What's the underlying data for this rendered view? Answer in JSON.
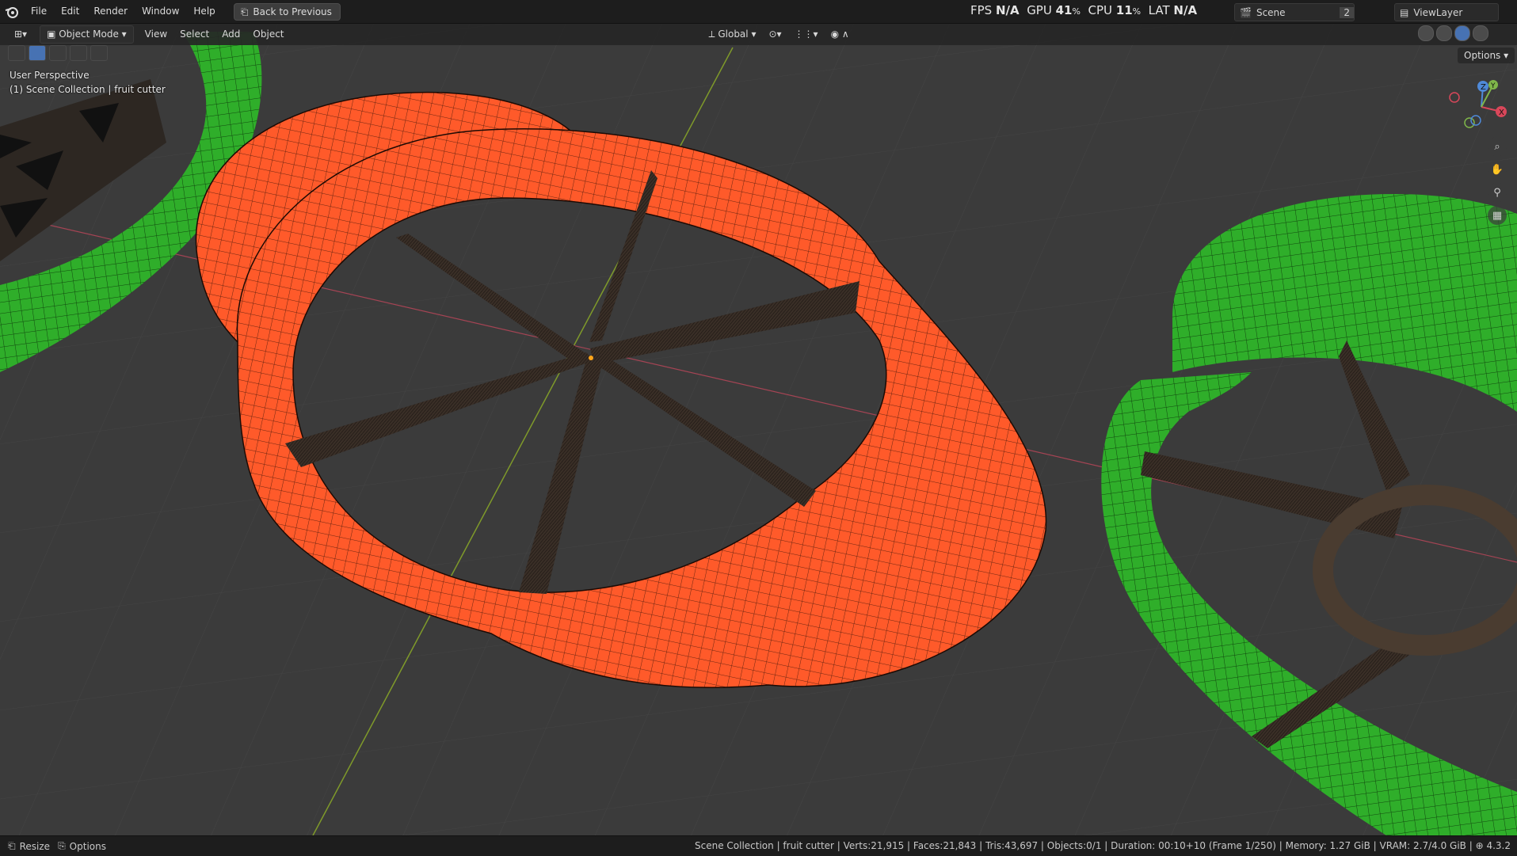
{
  "menu": {
    "items": [
      "File",
      "Edit",
      "Render",
      "Window",
      "Help"
    ],
    "back_button": "Back to Previous"
  },
  "stats": {
    "fps_label": "FPS",
    "fps_value": "N/A",
    "gpu_label": "GPU",
    "gpu_value": "41",
    "cpu_label": "CPU",
    "cpu_value": "11",
    "lat_label": "LAT",
    "lat_value": "N/A",
    "percent": "%"
  },
  "scene": {
    "name": "Scene",
    "users": "2"
  },
  "viewlayer": {
    "name": "ViewLayer"
  },
  "header": {
    "mode": "Object Mode",
    "view": "View",
    "select": "Select",
    "add": "Add",
    "object": "Object",
    "transform_orientation": "Global",
    "options": "Options"
  },
  "viewport": {
    "perspective": "User Perspective",
    "collection": "(1) Scene Collection | fruit cutter",
    "gizmo_labels": {
      "z": "Z",
      "y": "Y",
      "x": "X"
    }
  },
  "statusbar": {
    "left_1": "Resize",
    "left_2": "Options",
    "info": "Scene Collection | fruit cutter | Verts:21,915 | Faces:21,843 | Tris:43,697 | Objects:0/1 | Duration: 00:10+10 (Frame 1/250) | Memory: 1.27 GiB | VRAM: 2.7/4.0 GiB |",
    "version": "4.3.2"
  },
  "colors": {
    "orange_mesh": "#ff5a2a",
    "green_mesh": "#2fae2a",
    "blade": "#3a2f27",
    "background": "#3b3b3b"
  }
}
